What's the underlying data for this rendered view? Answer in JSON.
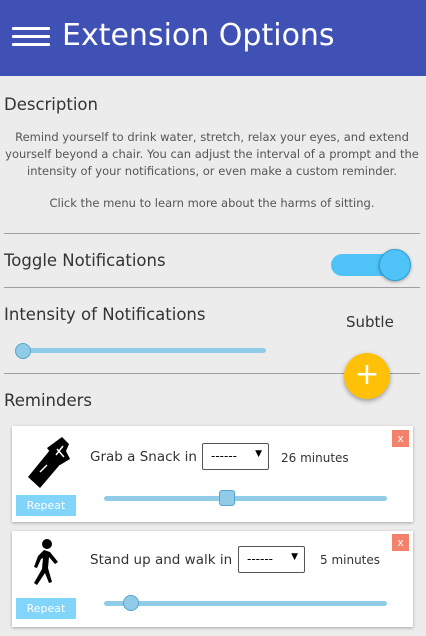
{
  "header": {
    "title": "Extension Options",
    "menu_icon": "hamburger-menu-icon"
  },
  "description": {
    "title": "Description",
    "paragraph1": "Remind yourself to drink water, stretch, relax your eyes, and extend yourself beyond a chair. You can adjust the interval of a prompt and the intensity of your notifications, or even make a custom reminder.",
    "paragraph2": "Click the menu to learn more about the harms of sitting."
  },
  "toggle_notifications": {
    "label": "Toggle Notifications",
    "enabled": true
  },
  "intensity": {
    "label": "Intensity of Notifications",
    "value_label": "Subtle",
    "level": 0
  },
  "add_button": {
    "icon": "plus-icon",
    "symbol": "+"
  },
  "reminders": {
    "title": "Reminders",
    "items": [
      {
        "icon": "snack-icon",
        "label": "Grab a Snack in",
        "select_value": "------",
        "minutes": "26 minutes",
        "repeat_label": "Repeat",
        "close_label": "x",
        "slider_level": 0.43
      },
      {
        "icon": "walking-person-icon",
        "label": "Stand up and walk in",
        "select_value": "------",
        "minutes": "5 minutes",
        "repeat_label": "Repeat",
        "close_label": "x",
        "slider_level": 0.09
      }
    ]
  },
  "colors": {
    "header": "#3f51b5",
    "accent": "#4fc3f7",
    "fab": "#ffc107",
    "close": "#f4826a"
  }
}
